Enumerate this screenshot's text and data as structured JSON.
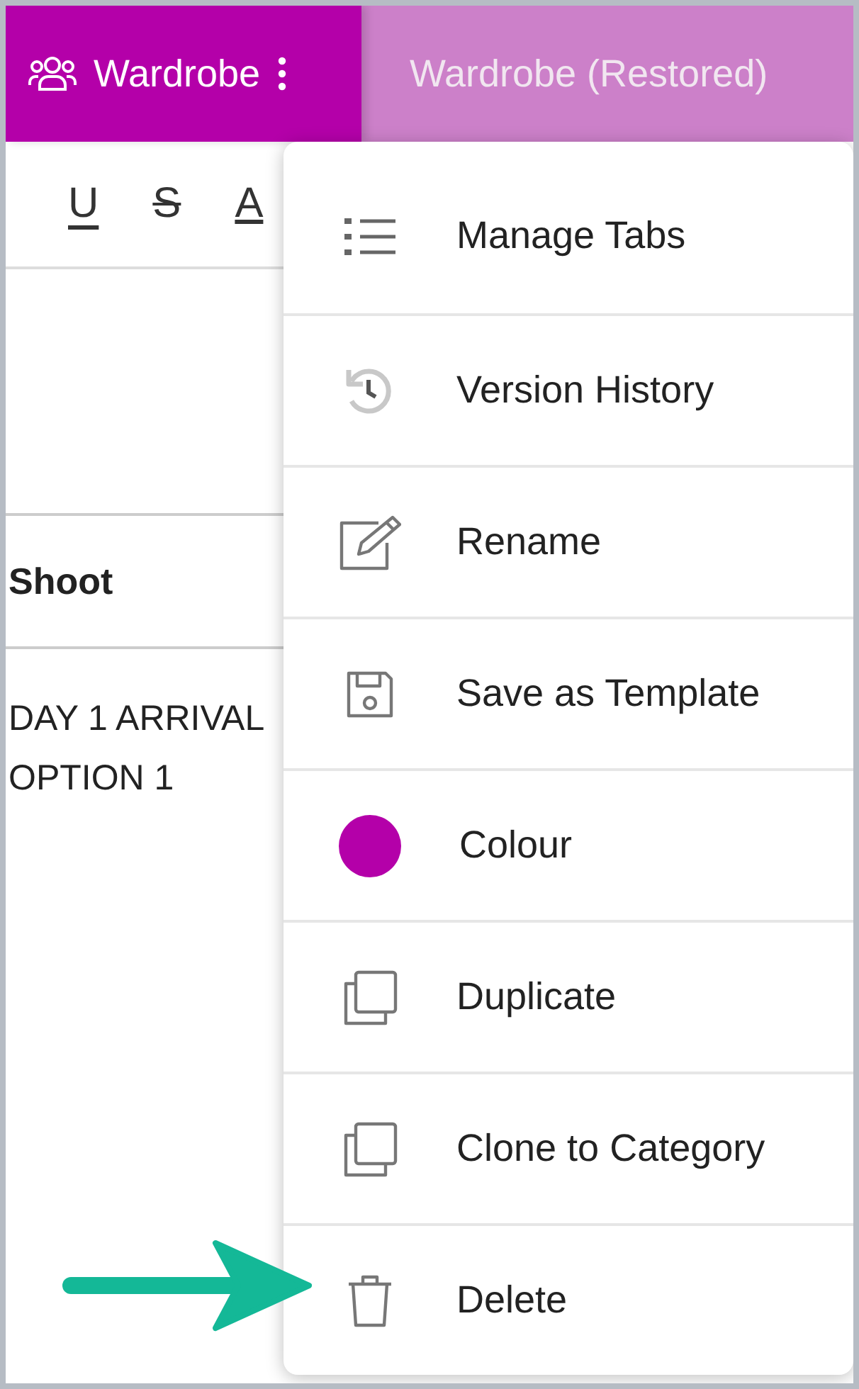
{
  "tabs": [
    {
      "label": "Wardrobe",
      "selected": true,
      "shared": true
    },
    {
      "label": "Wardrobe (Restored)",
      "selected": false,
      "shared": false
    }
  ],
  "toolbar": [
    "U",
    "S",
    "A"
  ],
  "table": {
    "header": "Shoot",
    "cell_lines": [
      "DAY 1 ARRIVAL",
      "OPTION 1"
    ]
  },
  "menu": {
    "items": [
      {
        "label": "Manage Tabs",
        "kind": "action"
      },
      {
        "label": "Version History",
        "kind": "action"
      },
      {
        "label": "Rename",
        "kind": "action"
      },
      {
        "label": "Save as Template",
        "kind": "action"
      },
      {
        "label": "Colour",
        "kind": "colour",
        "color": "#b400a9"
      },
      {
        "label": "Duplicate",
        "kind": "action"
      },
      {
        "label": "Clone to Category",
        "kind": "action"
      },
      {
        "label": "Delete",
        "kind": "action"
      }
    ]
  }
}
